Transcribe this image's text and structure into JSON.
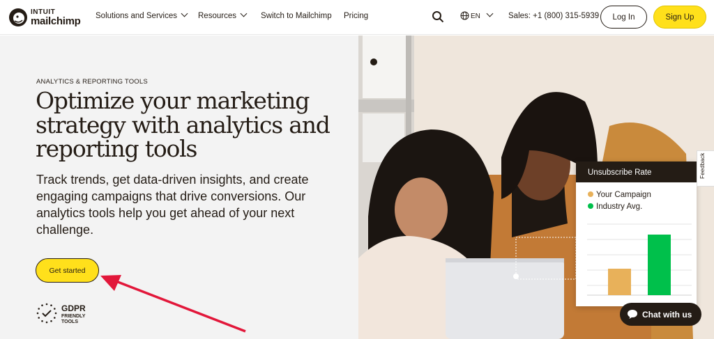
{
  "nav": {
    "brand_top": "INTUIT",
    "brand_bottom": "mailchimp",
    "links": [
      "Solutions and Services",
      "Resources",
      "Switch to Mailchimp",
      "Pricing"
    ],
    "language": "EN",
    "sales": "Sales: +1 (800) 315-5939",
    "login": "Log In",
    "signup": "Sign Up"
  },
  "hero": {
    "eyebrow": "ANALYTICS & REPORTING TOOLS",
    "title": "Optimize your marketing strategy with analytics and reporting tools",
    "description": "Track trends, get data-driven insights, and create engaging campaigns that drive conversions. Our analytics tools help you get ahead of your next challenge.",
    "cta": "Get started",
    "badge_title": "GDPR",
    "badge_sub1": "FRIENDLY",
    "badge_sub2": "TOOLS"
  },
  "widget": {
    "title": "Unsubscribe Rate",
    "legend": [
      {
        "label": "Your Campaign",
        "color": "#e8b15a"
      },
      {
        "label": "Industry Avg.",
        "color": "#00c04b"
      }
    ],
    "bar_values": [
      0.44,
      1.0
    ]
  },
  "feedback": "Feedback",
  "chat": "Chat with us",
  "colors": {
    "yellow": "#ffe01b",
    "dark": "#241c15",
    "arrow": "#e2173a"
  }
}
